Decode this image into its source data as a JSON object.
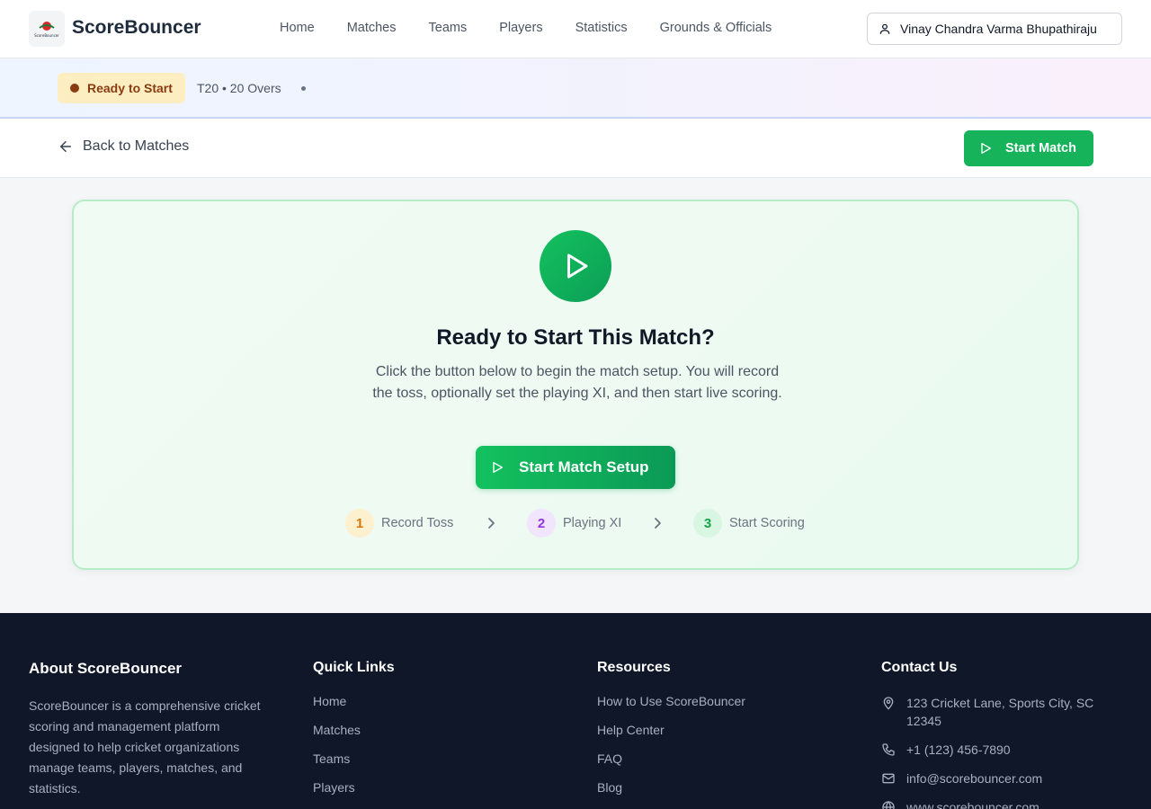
{
  "app": {
    "brand": "ScoreBouncer",
    "logo_text": "ScoreBouncer"
  },
  "nav": {
    "items": [
      {
        "label": "Home"
      },
      {
        "label": "Matches"
      },
      {
        "label": "Teams"
      },
      {
        "label": "Players"
      },
      {
        "label": "Statistics"
      },
      {
        "label": "Grounds & Officials"
      }
    ]
  },
  "user": {
    "name": "Vinay Chandra Varma Bhupathiraju",
    "icon": "user-icon"
  },
  "match_status": {
    "badge": "Ready to Start",
    "format": "T20 • 20 Overs"
  },
  "actions": {
    "back_label": "Back to Matches",
    "start_label": "Start Match"
  },
  "card": {
    "title": "Ready to Start This Match?",
    "description": "Click the button below to begin the match setup. You will record the toss, optionally set the playing XI, and then start live scoring.",
    "button_label": "Start Match Setup",
    "steps": [
      {
        "num": "1",
        "label": "Record Toss",
        "color": "#d97706",
        "bg": "#fdf0cf"
      },
      {
        "num": "2",
        "label": "Playing XI",
        "color": "#9333ea",
        "bg": "#f1e4fd"
      },
      {
        "num": "3",
        "label": "Start Scoring",
        "color": "#16a34a",
        "bg": "#d8f6e2"
      }
    ]
  },
  "footer": {
    "about_title": "About ScoreBouncer",
    "about_text": "ScoreBouncer is a comprehensive cricket scoring and management platform designed to help cricket organizations manage teams, players, matches, and statistics.",
    "quick_title": "Quick Links",
    "quick_links": [
      "Home",
      "Matches",
      "Teams",
      "Players"
    ],
    "resources_title": "Resources",
    "resources": [
      "How to Use ScoreBouncer",
      "Help Center",
      "FAQ",
      "Blog"
    ],
    "contact_title": "Contact Us",
    "contact": {
      "address": "123 Cricket Lane, Sports City, SC 12345",
      "phone": "+1 (123) 456-7890",
      "email": "info@scorebouncer.com",
      "website": "www.scorebouncer.com"
    }
  },
  "colors": {
    "accent_green": "#16b35a",
    "badge_bg": "#fdeec2",
    "badge_text": "#8a3b10",
    "footer_bg": "#0f1729"
  }
}
